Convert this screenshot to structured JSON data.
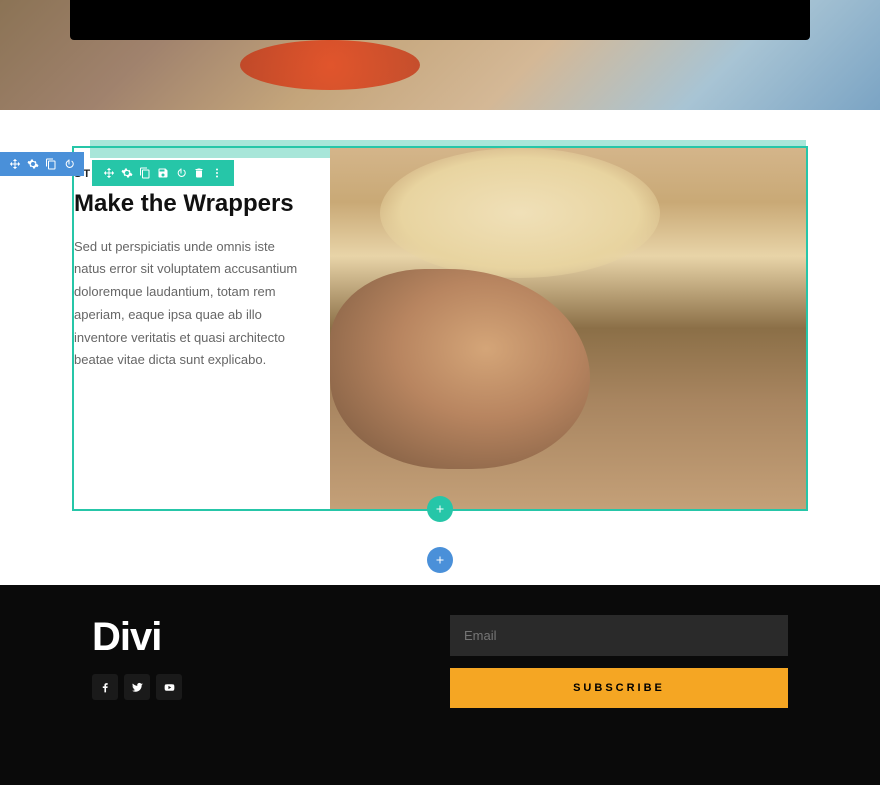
{
  "step": {
    "label": "STEP-01",
    "title": "Make the Wrappers",
    "body": "Sed ut perspiciatis unde omnis iste natus error sit voluptatem accusantium doloremque laudantium, totam rem aperiam, eaque ipsa quae ab illo inventore veritatis et quasi architecto beatae vitae dicta sunt explicabo."
  },
  "footer": {
    "logo": "Divi",
    "email_placeholder": "Email",
    "subscribe_label": "SUBSCRIBE"
  },
  "colors": {
    "section_accent": "#26c6a8",
    "row_accent": "#4a90d9",
    "cta": "#f5a623"
  }
}
